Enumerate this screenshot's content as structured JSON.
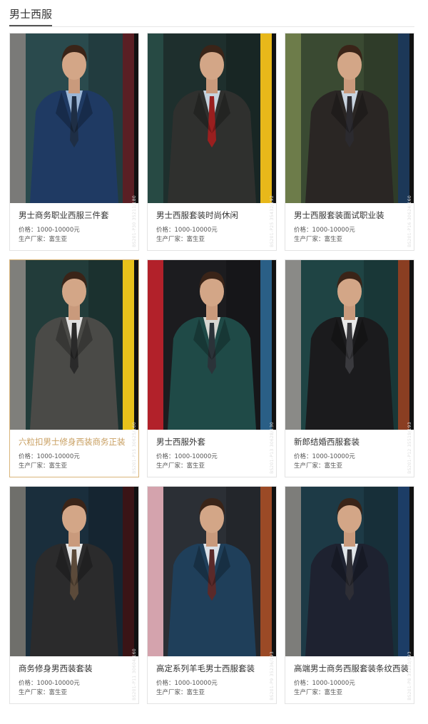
{
  "page": {
    "title": "男士西服"
  },
  "labels": {
    "price_prefix": "价格：",
    "maker_prefix": "生产厂家："
  },
  "products": [
    {
      "name": "男士商务职业西服三件套",
      "price": "价格：1000-10000元",
      "maker": "生产厂家：富生亚",
      "code": "BS201-P30 35211/180",
      "colors": {
        "bg": "#2a4a4d",
        "wall": "#7a7a78",
        "stripe": "#5a1f24",
        "suit": "#1f3a63",
        "shirt": "#9bb6d6",
        "tie": "#1e2e45"
      }
    },
    {
      "name": "男士西服套装时尚休闲",
      "price": "价格：1000-10000元",
      "maker": "生产厂家：富生亚",
      "code": "BS201-P25 35432/192",
      "colors": {
        "bg": "#1e2f2d",
        "wall": "#274a44",
        "stripe": "#e8b81a",
        "suit": "#2f302e",
        "shirt": "#c6d3de",
        "tie": "#9a1f1f"
      }
    },
    {
      "name": "男士西服套装面试职业装",
      "price": "价格：1000-10000元",
      "maker": "生产厂家：富生亚",
      "code": "BS201-P16 30624/160",
      "colors": {
        "bg": "#3a4a32",
        "wall": "#6d7c4a",
        "stripe": "#1c3858",
        "suit": "#2a2624",
        "shirt": "#c9d4e0",
        "tie": "#2b2a2f"
      }
    },
    {
      "name": "六粒扣男士修身西装商务正装",
      "price": "价格：1000-10000元",
      "maker": "生产厂家：富生亚",
      "code": "BS201-P15 30625/160",
      "colors": {
        "bg": "#223c3a",
        "wall": "#7f7f7b",
        "stripe": "#e8c21b",
        "suit": "#4a4a47",
        "shirt": "#e0e0e0",
        "tie": "#2a2a2a"
      }
    },
    {
      "name": "男士西服外套",
      "price": "价格：1000-10000元",
      "maker": "生产厂家：富生亚",
      "code": "BS201-P13 30628/130",
      "colors": {
        "bg": "#1c1c1f",
        "wall": "#b2212a",
        "stripe": "#2a5f86",
        "suit": "#1f4a47",
        "shirt": "#d7d7d2",
        "tie": "#2b3339"
      }
    },
    {
      "name": "新郎结婚西服套装",
      "price": "价格：1000-10000元",
      "maker": "生产厂家：富生亚",
      "code": "BS201-P12 35519/193",
      "colors": {
        "bg": "#1f4444",
        "wall": "#8a8a87",
        "stripe": "#8a3e22",
        "suit": "#1b1b1d",
        "shirt": "#e9e9e9",
        "tie": "#3a3a3e"
      }
    },
    {
      "name": "商务修身男西装套装",
      "price": "价格：1000-10000元",
      "maker": "生产厂家：富生亚",
      "code": "BS201-P11 30604/160",
      "colors": {
        "bg": "#1a2e3c",
        "wall": "#6f6f6b",
        "stripe": "#3a1416",
        "suit": "#2b2b2c",
        "shirt": "#e4e4e4",
        "tie": "#5b4a3a"
      }
    },
    {
      "name": "高定系列羊毛男士西服套装",
      "price": "价格：1000-10000元",
      "maker": "生产厂家：富生亚",
      "code": "BS201-P9 35236/193",
      "colors": {
        "bg": "#2b2f35",
        "wall": "#d4a3ad",
        "stripe": "#9b4a26",
        "suit": "#1f3f5a",
        "shirt": "#dbe1e8",
        "tie": "#5b2a2a"
      }
    },
    {
      "name": "高端男士商务西服套装条纹西装",
      "price": "价格：1000-10000元",
      "maker": "生产厂家：富生亚",
      "code": "BS201-P8 35233/193",
      "colors": {
        "bg": "#1d3a46",
        "wall": "#7d7d7a",
        "stripe": "#1c3d66",
        "suit": "#1e2230",
        "shirt": "#e2e6ea",
        "tie": "#2e2e35"
      }
    }
  ],
  "active_index": 3,
  "colors": {
    "text": "#333333",
    "active_text": "#c9a063",
    "active_border": "#d9b57a",
    "border": "#e3e3e3"
  }
}
